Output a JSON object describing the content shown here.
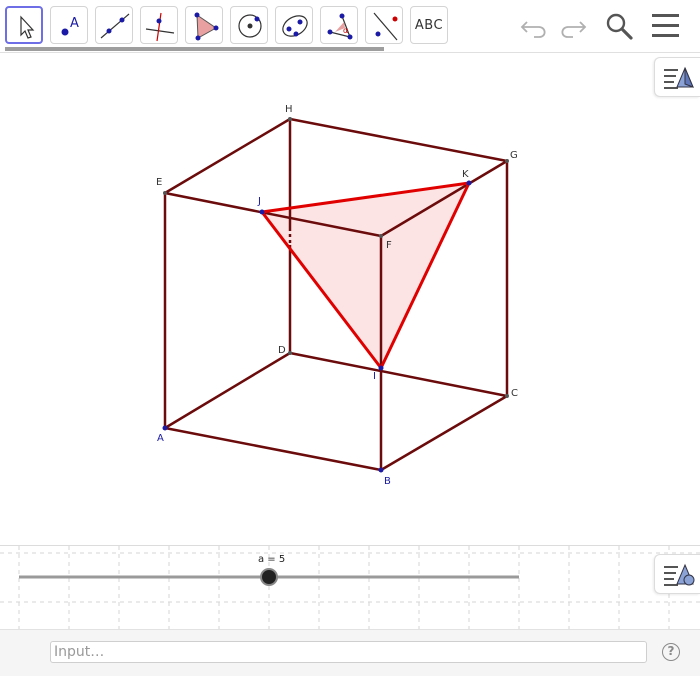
{
  "toolbar": {
    "tools": [
      {
        "name": "move",
        "label": ""
      },
      {
        "name": "point",
        "label": "A"
      },
      {
        "name": "line",
        "label": ""
      },
      {
        "name": "perpendicular",
        "label": ""
      },
      {
        "name": "polygon",
        "label": ""
      },
      {
        "name": "circle",
        "label": ""
      },
      {
        "name": "ellipse",
        "label": ""
      },
      {
        "name": "angle",
        "label": "α"
      },
      {
        "name": "reflect",
        "label": ""
      },
      {
        "name": "text",
        "label": "ABC"
      }
    ],
    "active_tool": "move"
  },
  "colors": {
    "edge": "#6b0b0b",
    "triangle": "#e00000",
    "triangle_fill": "#fcdede",
    "point_blue": "#1a1aa6",
    "point_gray": "#555555"
  },
  "points": {
    "A": "A",
    "B": "B",
    "C": "C",
    "D": "D",
    "E": "E",
    "F": "F",
    "G": "G",
    "H": "H",
    "I": "I",
    "J": "J",
    "K": "K"
  },
  "slider": {
    "label": "a = 5",
    "value": 5
  },
  "input": {
    "placeholder": "Input…"
  },
  "help": {
    "label": "?"
  }
}
